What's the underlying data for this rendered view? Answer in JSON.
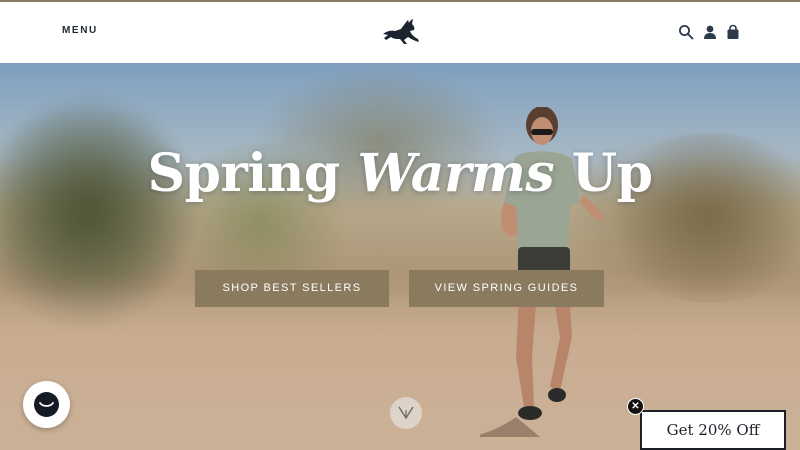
{
  "header": {
    "menu_label": "MENU",
    "logo_name": "jackrabbit-logo",
    "icons": [
      "search-icon",
      "account-icon",
      "shopping-bag-icon"
    ]
  },
  "hero": {
    "headline_regular_1": "Spring ",
    "headline_italic": "Warms",
    "headline_regular_2": " Up",
    "buttons": [
      {
        "label": "SHOP BEST SELLERS"
      },
      {
        "label": "VIEW SPRING GUIDES"
      }
    ],
    "scroll_icon": "chevron-down-icon"
  },
  "chat": {
    "icon": "chat-icon"
  },
  "promo": {
    "label": "Get 20% Off",
    "close_icon": "close-icon"
  },
  "colors": {
    "accent_bar": "#8a7b5f",
    "button_bg": "#8a7a5e",
    "brand_dark": "#1c2430"
  }
}
